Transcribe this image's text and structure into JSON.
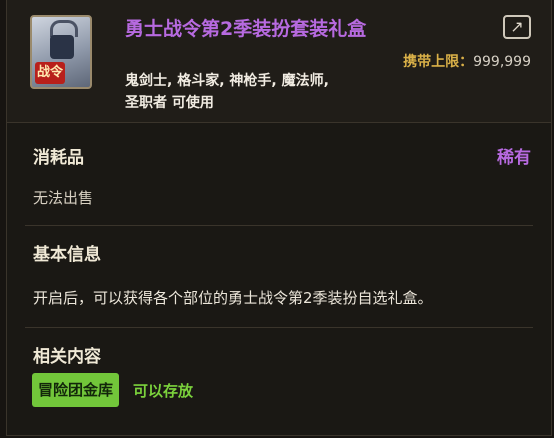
{
  "item": {
    "title": "勇士战令第2季装扮套装礼盒",
    "icon_badge": "战令",
    "icon_name": "gift-bag-icon",
    "carry_limit_label": "携带上限：",
    "carry_limit_value": "999,999",
    "classes_line1": "鬼剑士, 格斗家, 神枪手, 魔法师,",
    "classes_line2": "圣职者 可使用"
  },
  "category": {
    "type": "消耗品",
    "rarity": "稀有",
    "rarity_color": "#b76ae0",
    "sell_status": "无法出售"
  },
  "basic_info": {
    "heading": "基本信息",
    "description": "开启后，可以获得各个部位的勇士战令第2季装扮自选礼盒。"
  },
  "related": {
    "heading": "相关内容",
    "storage_label": "冒险团金库",
    "storage_note": "可以存放"
  }
}
